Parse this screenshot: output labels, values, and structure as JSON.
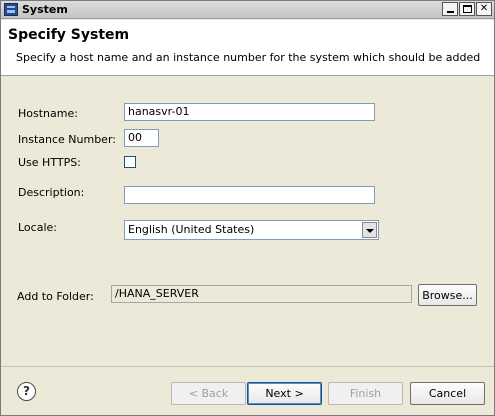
{
  "window": {
    "title": "System"
  },
  "header": {
    "title": "Specify System",
    "description": "Specify a host name and an instance number for the system which should be added"
  },
  "form": {
    "hostname_label": "Hostname:",
    "hostname_value": "hanasvr-01",
    "instance_label": "Instance Number:",
    "instance_value": "00",
    "https_label": "Use HTTPS:",
    "https_checked": false,
    "description_label": "Description:",
    "description_value": "",
    "locale_label": "Locale:",
    "locale_value": "English (United States)",
    "folder_label": "Add to Folder:",
    "folder_value": "/HANA_SERVER",
    "browse_label": "Browse..."
  },
  "footer": {
    "back_label": "< Back",
    "next_label": "Next >",
    "finish_label": "Finish",
    "cancel_label": "Cancel"
  }
}
